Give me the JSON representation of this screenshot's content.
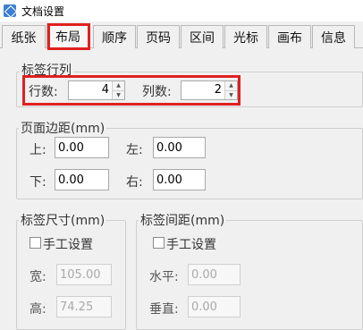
{
  "window": {
    "title": "文档设置"
  },
  "tabs": [
    {
      "label": "纸张"
    },
    {
      "label": "布局"
    },
    {
      "label": "顺序"
    },
    {
      "label": "页码"
    },
    {
      "label": "区间"
    },
    {
      "label": "光标"
    },
    {
      "label": "画布"
    },
    {
      "label": "信息"
    }
  ],
  "active_tab": "布局",
  "label_rows_cols": {
    "title": "标签行列",
    "rows_label": "行数:",
    "rows_value": "4",
    "cols_label": "列数:",
    "cols_value": "2"
  },
  "margins": {
    "title": "页面边距(mm)",
    "top_label": "上:",
    "top_value": "0.00",
    "left_label": "左:",
    "left_value": "0.00",
    "bottom_label": "下:",
    "bottom_value": "0.00",
    "right_label": "右:",
    "right_value": "0.00"
  },
  "label_size": {
    "title": "标签尺寸(mm)",
    "manual_label": "手工设置",
    "width_label": "宽:",
    "width_value": "105.00",
    "height_label": "高:",
    "height_value": "74.25"
  },
  "label_spacing": {
    "title": "标签间距(mm)",
    "manual_label": "手工设置",
    "horizontal_label": "水平:",
    "horizontal_value": "0.00",
    "vertical_label": "垂直:",
    "vertical_value": "0.00"
  },
  "colors": {
    "highlight": "#e02020",
    "accent": "#3d7fd1"
  }
}
